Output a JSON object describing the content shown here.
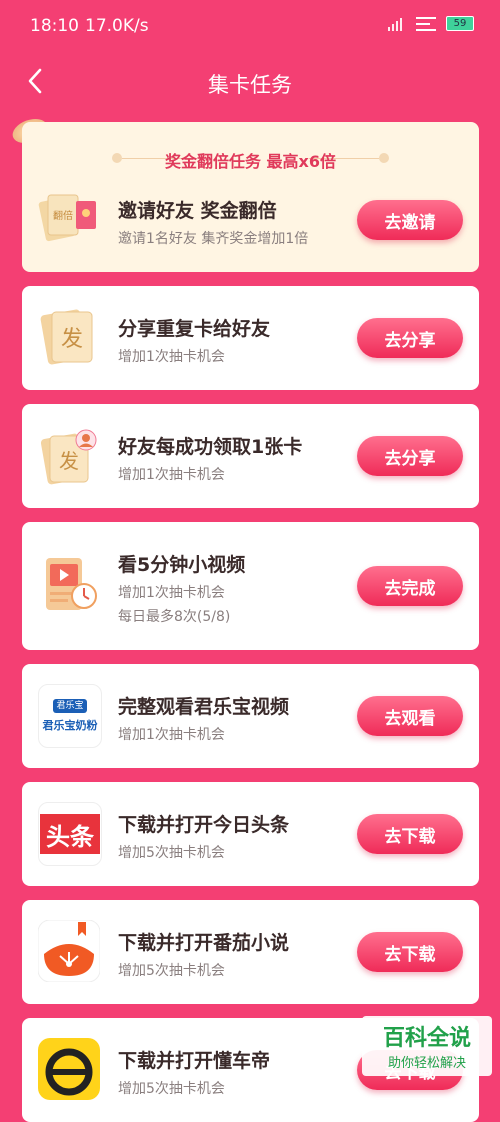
{
  "status": {
    "time": "18:10",
    "speed": "17.0K/s",
    "battery": "59"
  },
  "nav": {
    "title": "集卡任务"
  },
  "banner": {
    "title": "奖金翻倍任务 最高x6倍"
  },
  "tasks": [
    {
      "title": "邀请好友 奖金翻倍",
      "sub": "邀请1名好友 集齐奖金增加1倍",
      "button": "去邀请",
      "icon": "double-reward-card-icon"
    },
    {
      "title": "分享重复卡给好友",
      "sub": "增加1次抽卡机会",
      "button": "去分享",
      "icon": "fa-card-icon"
    },
    {
      "title": "好友每成功领取1张卡",
      "sub": "增加1次抽卡机会",
      "button": "去分享",
      "icon": "fa-card-friend-icon"
    },
    {
      "title": "看5分钟小视频",
      "sub": "增加1次抽卡机会",
      "sub2": "每日最多8次(5/8)",
      "button": "去完成",
      "icon": "video-timer-icon"
    },
    {
      "title": "完整观看君乐宝视频",
      "sub": "增加1次抽卡机会",
      "button": "去观看",
      "icon": "junlebao-logo-icon",
      "logo_top": "君乐宝",
      "logo_bottom": "君乐宝奶粉"
    },
    {
      "title": "下载并打开今日头条",
      "sub": "增加5次抽卡机会",
      "button": "去下载",
      "icon": "toutiao-logo-icon",
      "logo_text": "头条"
    },
    {
      "title": "下载并打开番茄小说",
      "sub": "增加5次抽卡机会",
      "button": "去下载",
      "icon": "fanqie-novel-icon"
    },
    {
      "title": "下载并打开懂车帝",
      "sub": "增加5次抽卡机会",
      "button": "去下载",
      "icon": "dongchedi-icon"
    }
  ],
  "watermark": {
    "line1": "百科全说",
    "line2": "助你轻松解决"
  },
  "colors": {
    "background": "#f43f73",
    "accent": "#ef2b58",
    "title_text": "#3a2a2a"
  }
}
